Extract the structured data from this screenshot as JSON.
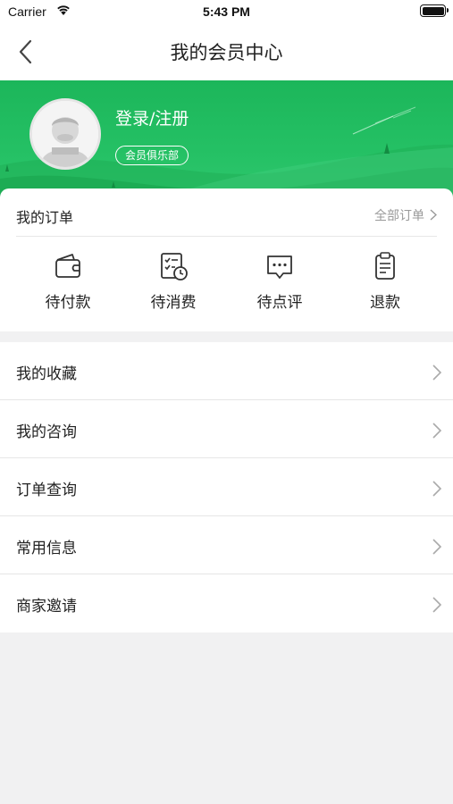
{
  "status_bar": {
    "carrier": "Carrier",
    "time": "5:43 PM"
  },
  "nav": {
    "title": "我的会员中心",
    "back_icon": "chevron-left-icon"
  },
  "profile": {
    "login_label": "登录/注册",
    "club_badge": "会员俱乐部",
    "avatar_icon": "default-avatar-icon"
  },
  "colors": {
    "brand_green": "#25c165",
    "text_dark": "#222222",
    "text_gray": "#999999",
    "background": "#f1f1f2"
  },
  "orders": {
    "title": "我的订单",
    "all_link": "全部订单",
    "items": [
      {
        "label": "待付款",
        "icon": "wallet-icon"
      },
      {
        "label": "待消费",
        "icon": "checklist-clock-icon"
      },
      {
        "label": "待点评",
        "icon": "comment-icon"
      },
      {
        "label": "退款",
        "icon": "clipboard-icon"
      }
    ]
  },
  "menu": [
    {
      "label": "我的收藏"
    },
    {
      "label": "我的咨询"
    },
    {
      "label": "订单查询"
    },
    {
      "label": "常用信息"
    },
    {
      "label": "商家邀请"
    }
  ]
}
